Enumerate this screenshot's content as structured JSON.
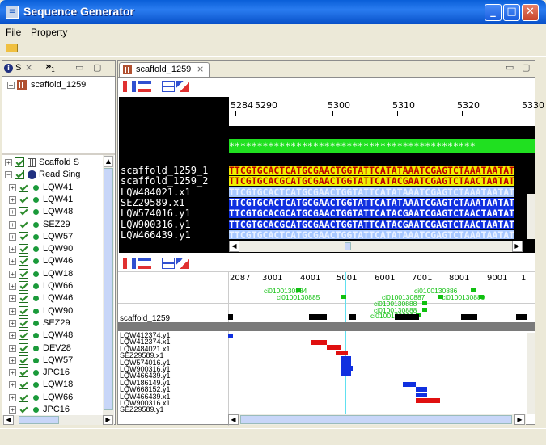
{
  "window": {
    "title": "Sequence Generator",
    "min": "_",
    "max": "□",
    "close": "✕"
  },
  "menu": {
    "file": "File",
    "property": "Property"
  },
  "left_panel": {
    "tab_label": "S",
    "more": "»",
    "more_count": "1",
    "top_tree": {
      "item": "scaffold_1259"
    },
    "tree_items": [
      {
        "label": "Scaffold S",
        "kind": "scaffold"
      },
      {
        "label": "Read Sing",
        "kind": "readgroup"
      },
      {
        "label": "LQW41",
        "kind": "read"
      },
      {
        "label": "LQW41",
        "kind": "read"
      },
      {
        "label": "LQW48",
        "kind": "read"
      },
      {
        "label": "SEZ29",
        "kind": "read"
      },
      {
        "label": "LQW57",
        "kind": "read"
      },
      {
        "label": "LQW90",
        "kind": "read"
      },
      {
        "label": "LQW46",
        "kind": "read"
      },
      {
        "label": "LQW18",
        "kind": "read"
      },
      {
        "label": "LQW66",
        "kind": "read"
      },
      {
        "label": "LQW46",
        "kind": "read"
      },
      {
        "label": "LQW90",
        "kind": "read"
      },
      {
        "label": "SEZ29",
        "kind": "read"
      },
      {
        "label": "LQW48",
        "kind": "read"
      },
      {
        "label": "DEV28",
        "kind": "read"
      },
      {
        "label": "LQW57",
        "kind": "read"
      },
      {
        "label": "JPC16",
        "kind": "read"
      },
      {
        "label": "LQW18",
        "kind": "read"
      },
      {
        "label": "LQW66",
        "kind": "read"
      },
      {
        "label": "JPC16",
        "kind": "read"
      }
    ]
  },
  "editor": {
    "tab_label": "scaffold_1259",
    "ruler": [
      "5284",
      "5290",
      "5300",
      "5310",
      "5320",
      "5330"
    ],
    "consensus_stars": "********************************************",
    "sequences": [
      {
        "name": "scaffold_1259_1",
        "seq": "TTCGTGCACTCATGCGAACTGGTATTCATATAAATCGAGTCTAAATAATAT",
        "bg": "#f0f000",
        "color": "#c00000"
      },
      {
        "name": "scaffold_1259_2",
        "seq": "TTCGTGCACGCATGCGAACTGGTATTCATACGAATCGAGTCTAACTAATAT",
        "bg": "#f0f000",
        "color": "#c00000"
      },
      {
        "name": "LQW484021.x1",
        "seq": "TTCGTGCACTCATGCGAACTGGTATTCATATAAATCGAGTCTAAATAATAT",
        "bg": "#a8c8ff",
        "color": "#e8f0ff"
      },
      {
        "name": "SEZ29589.x1",
        "seq": "TTCGTGCACTCATGCGAACTGGTATTCATATAAATCGAGTCTAAATAATAT",
        "bg": "#1030e0",
        "color": "#ffffff"
      },
      {
        "name": "LQW574016.y1",
        "seq": "TTCGTGCACGCATGCGAACTGGTATTCATACGAATCGAGTCTAACTAATAT",
        "bg": "#1030e0",
        "color": "#ffffff"
      },
      {
        "name": "LQW900316.y1",
        "seq": "TTCGTGCACGCATGCGAACTGGTATTCATACGAATCGAGTCTAACTAATAT",
        "bg": "#1030e0",
        "color": "#ffffff"
      },
      {
        "name": "LQW466439.y1",
        "seq": "TTCGTGCACTCATGCGAACTGGTATTCATATAAATCGAGTCTAAATAATAT",
        "bg": "#a8c8ff",
        "color": "#e8f0ff"
      }
    ]
  },
  "overview": {
    "ticks": [
      "2087",
      "3001",
      "4001",
      "5001",
      "6001",
      "7001",
      "8001",
      "9001",
      "10"
    ],
    "clones": [
      "ci0100130884",
      "ci0100130885",
      "ci0100130886",
      "ci0100130887",
      "ci0100130888",
      "ci0100130889",
      "ci0100130888",
      "ci0100130880"
    ],
    "scaffold_label": "scaffold_1259",
    "reads": [
      "LQW412374.y1",
      "LQW412374.x1",
      "LQW484021.x1",
      "SEZ29589.x1",
      "LQW574016.y1",
      "LQW900316.y1",
      "LQW466439.y1",
      "LQW186149.y1",
      "LQW668152.y1",
      "LQW466439.x1",
      "LQW900316.x1",
      "SEZ29589.y1"
    ]
  },
  "colors": {
    "titlebar": "#0a5fd8",
    "consensus": "#20e020",
    "reference": "#f0f000",
    "read_fwd": "#1030e0",
    "read_light": "#a8c8ff",
    "read_red": "#e01010",
    "cursor": "#60e0f0"
  }
}
